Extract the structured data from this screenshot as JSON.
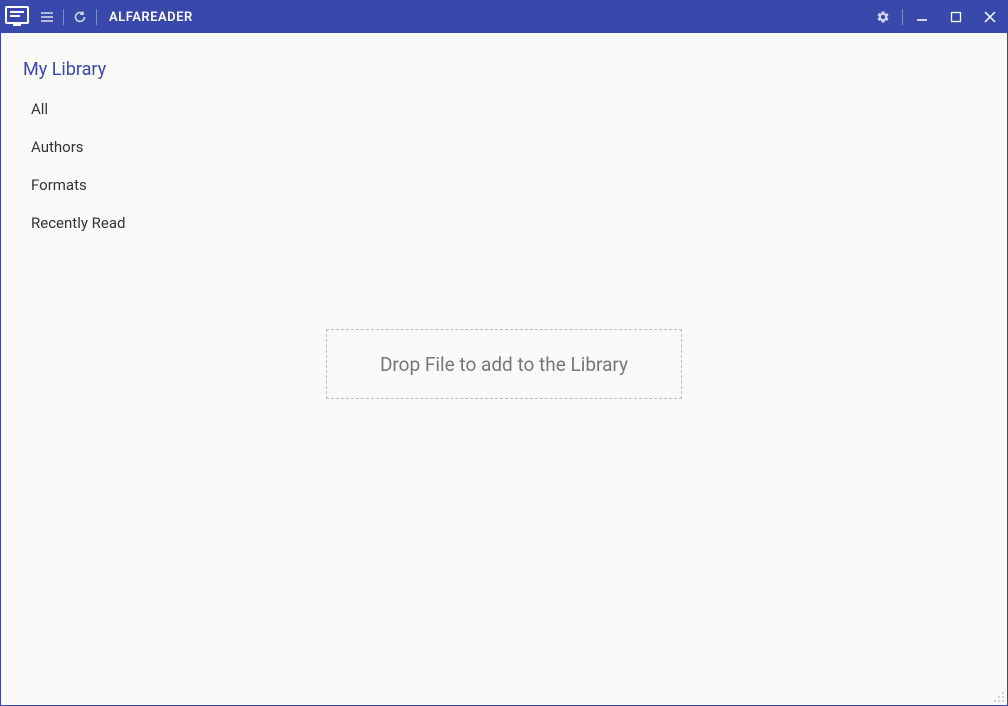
{
  "app": {
    "title": "ALFAREADER"
  },
  "sidebar": {
    "title": "My Library",
    "items": [
      {
        "label": "All"
      },
      {
        "label": "Authors"
      },
      {
        "label": "Formats"
      },
      {
        "label": "Recently Read"
      }
    ]
  },
  "main": {
    "dropzone_text": "Drop File to add to the Library"
  },
  "colors": {
    "primary": "#3949ab",
    "background": "#fafafa",
    "text": "#333",
    "muted": "#777"
  }
}
